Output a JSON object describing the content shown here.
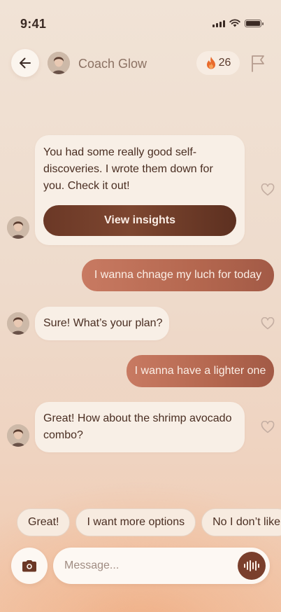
{
  "status_bar": {
    "time": "9:41"
  },
  "header": {
    "coach_name": "Coach Glow",
    "streak_count": "26",
    "icons": {
      "back": "arrow-left-icon",
      "streak": "fire-icon",
      "report": "flag-icon"
    }
  },
  "messages": [
    {
      "sender": "coach",
      "text": "You had some really good self-discoveries. I wrote them down for you. Check it out!",
      "button_label": "View insights"
    },
    {
      "sender": "user",
      "text": "I wanna chnage my luch for today"
    },
    {
      "sender": "coach",
      "text": "Sure! What’s your plan?"
    },
    {
      "sender": "user",
      "text": "I wanna have a lighter one"
    },
    {
      "sender": "coach",
      "text": "Great! How about the shrimp avocado combo?"
    }
  ],
  "quick_replies": [
    "Great!",
    "I want more options",
    "No I don’t like"
  ],
  "composer": {
    "placeholder": "Message...",
    "icons": {
      "camera": "camera-icon",
      "voice": "voice-wave-icon"
    }
  },
  "colors": {
    "accent_dark": "#6b3826",
    "user_bubble": "#b4674f",
    "coach_bubble": "#f8efe6",
    "flame": "#e86a2c"
  }
}
